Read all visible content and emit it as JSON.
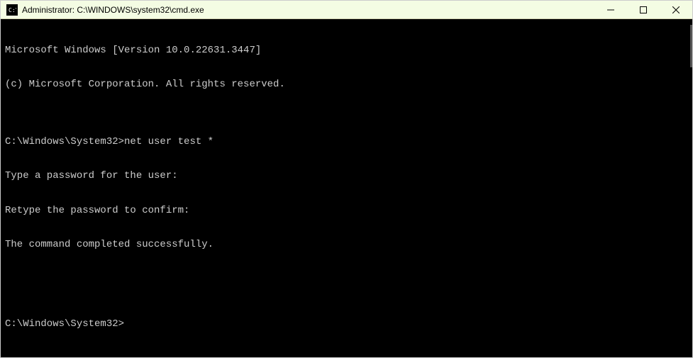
{
  "window": {
    "title": "Administrator: C:\\WINDOWS\\system32\\cmd.exe"
  },
  "terminal": {
    "lines": [
      "Microsoft Windows [Version 10.0.22631.3447]",
      "(c) Microsoft Corporation. All rights reserved.",
      "",
      "C:\\Windows\\System32>net user test *",
      "Type a password for the user:",
      "Retype the password to confirm:",
      "The command completed successfully.",
      "",
      "",
      "C:\\Windows\\System32>"
    ]
  }
}
